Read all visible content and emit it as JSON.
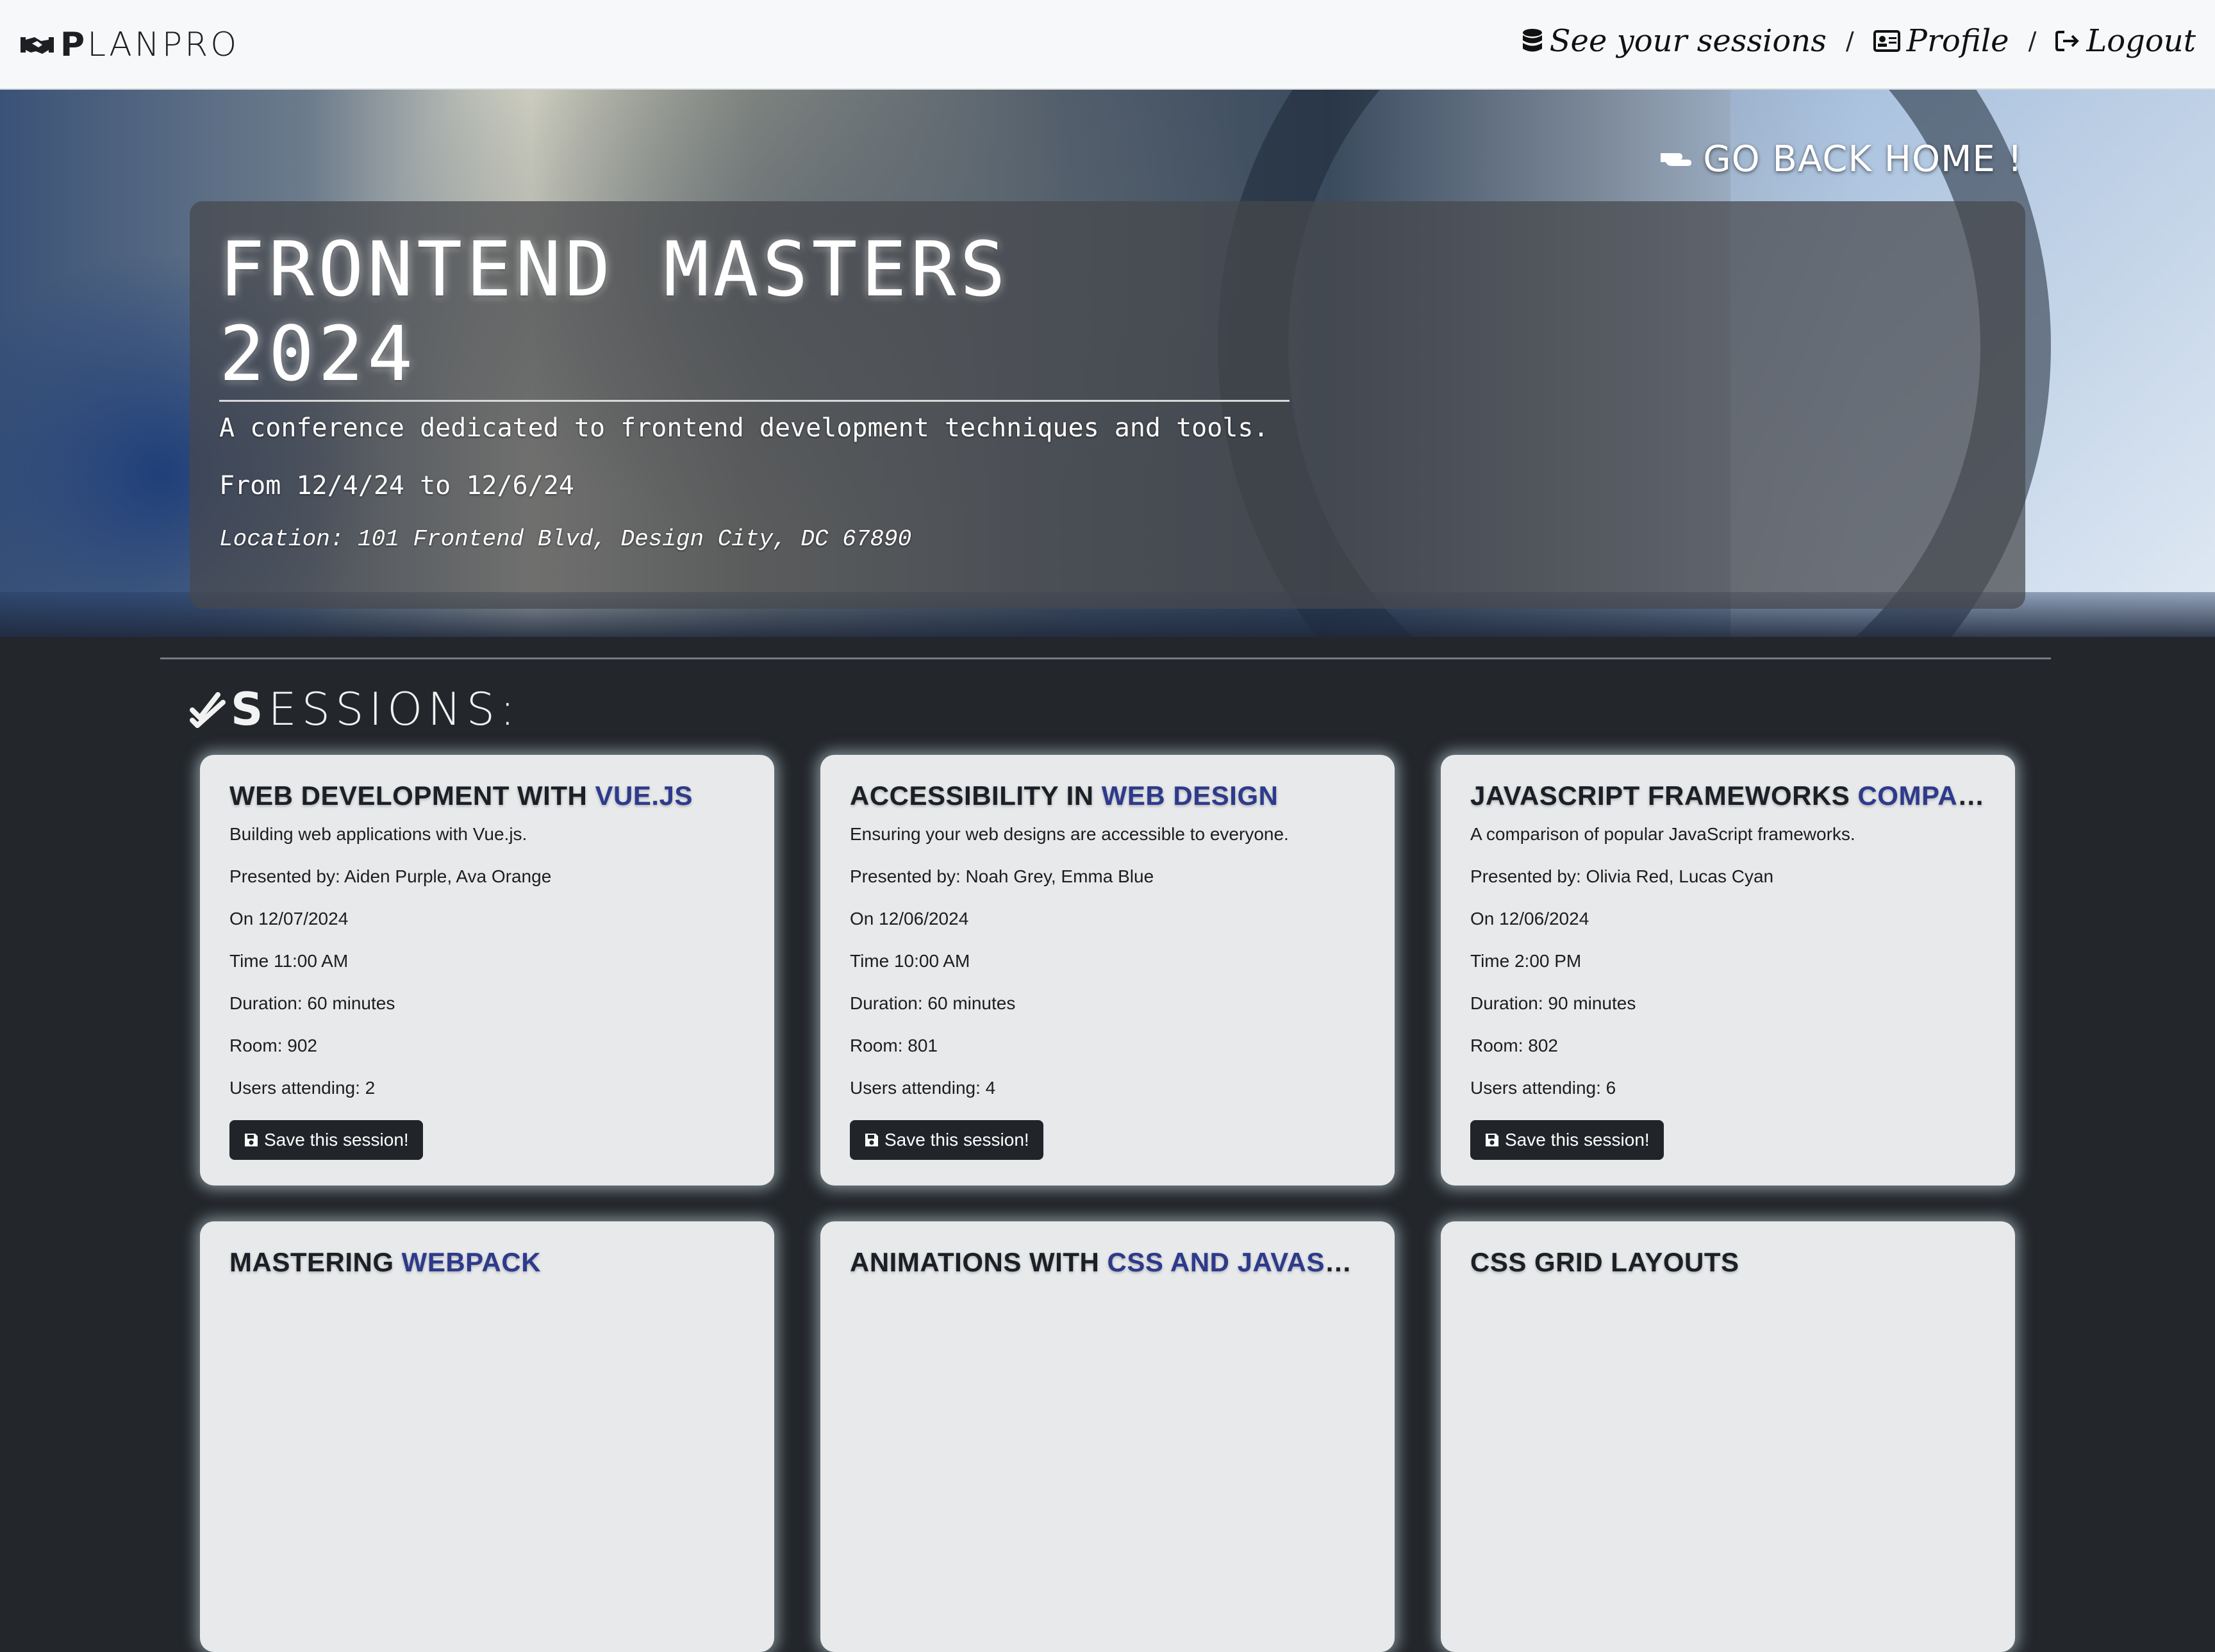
{
  "brand": {
    "name_bold": "P",
    "name_rest": "LANPRO"
  },
  "nav": {
    "sessions_label": "See your sessions",
    "separator": "/",
    "profile_label": "Profile",
    "logout_label": "Logout"
  },
  "hero": {
    "home_link": "GO BACK HOME !",
    "title_line1": "FRONTEND MASTERS",
    "title_line2": "2024",
    "description": "A conference dedicated to frontend development techniques and tools.",
    "dates": "From 12/4/24 to 12/6/24",
    "location": "Location: 101 Frontend Blvd, Design City, DC 67890"
  },
  "sessions_heading": {
    "bold": "S",
    "rest": "ESSIONS:"
  },
  "sessions": [
    {
      "title_a": "WEB DEVELOPMENT WITH ",
      "title_b": "VUE.JS",
      "description": "Building web applications with Vue.js.",
      "presenters": "Presented by: Aiden Purple, Ava Orange",
      "date": "On 12/07/2024",
      "time": "Time 11:00 AM",
      "duration": "Duration: 60 minutes",
      "room": "Room: 902",
      "attending": "Users attending: 2",
      "button": "Save this session!"
    },
    {
      "title_a": "ACCESSIBILITY IN ",
      "title_b": "WEB DESIGN",
      "description": "Ensuring your web designs are accessible to everyone.",
      "presenters": "Presented by: Noah Grey, Emma Blue",
      "date": "On 12/06/2024",
      "time": "Time 10:00 AM",
      "duration": "Duration: 60 minutes",
      "room": "Room: 801",
      "attending": "Users attending: 4",
      "button": "Save this session!"
    },
    {
      "title_a": "JAVASCRIPT FRAMEWORKS ",
      "title_b": "COMPARI...",
      "description": "A comparison of popular JavaScript frameworks.",
      "presenters": "Presented by: Olivia Red, Lucas Cyan",
      "date": "On 12/06/2024",
      "time": "Time 2:00 PM",
      "duration": "Duration: 90 minutes",
      "room": "Room: 802",
      "attending": "Users attending: 6",
      "button": "Save this session!"
    },
    {
      "title_a": "MASTERING ",
      "title_b": "WEBPACK"
    },
    {
      "title_a": "ANIMATIONS WITH ",
      "title_b": "CSS AND JAVASCRIPT"
    },
    {
      "title_a": "CSS GRID LAYOUTS",
      "title_b": ""
    }
  ],
  "colors": {
    "accent": "#2d3a8c",
    "background": "#23272b",
    "card": "#e7e9ea",
    "button": "#212529"
  }
}
